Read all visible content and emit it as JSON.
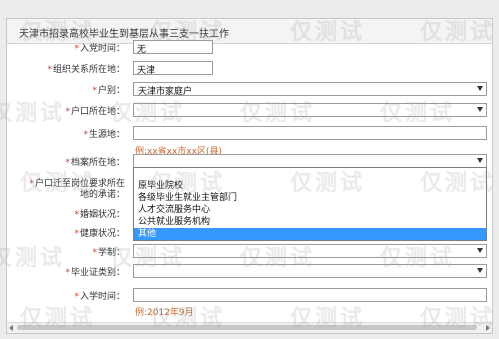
{
  "window": {
    "title": "天津市招录高校毕业生到基层从事三支一扶工作"
  },
  "form": {
    "rows": [
      {
        "required": true,
        "label": "入党时间：",
        "value": "无",
        "kind": "text"
      },
      {
        "required": true,
        "label": "组织关系所在地：",
        "value": "天津",
        "kind": "text-short"
      },
      {
        "required": true,
        "label": "户别：",
        "value": "天津市家庭户",
        "kind": "select"
      },
      {
        "required": true,
        "label": "户口所在地：",
        "value": "",
        "kind": "select"
      },
      {
        "required": true,
        "label": "生源地：",
        "value": "",
        "kind": "text",
        "hint": "例:xx省xx市xx区(县)"
      },
      {
        "required": true,
        "label": "档案所在地：",
        "value": "",
        "kind": "select"
      },
      {
        "required": true,
        "label": "户口迁至岗位要求所在地的承诺：",
        "value": "",
        "kind": "select"
      },
      {
        "required": true,
        "label": "婚姻状况：",
        "value": "",
        "kind": "select"
      },
      {
        "required": true,
        "label": "健康状况：",
        "value": "",
        "kind": "select"
      },
      {
        "required": true,
        "label": "学制：",
        "value": "",
        "kind": "select"
      },
      {
        "required": true,
        "label": "毕业证类别：",
        "value": "",
        "kind": "select"
      },
      {
        "required": true,
        "label": "入学时间：",
        "value": "",
        "kind": "text",
        "hint": "例:2012年9月"
      }
    ]
  },
  "dropdown": {
    "options": [
      "原毕业院校",
      "各级毕业生就业主管部门",
      "人才交流服务中心",
      "公共就业服务机构",
      "其他"
    ],
    "selected_index": 5
  },
  "watermark": {
    "text": "仅测试"
  }
}
